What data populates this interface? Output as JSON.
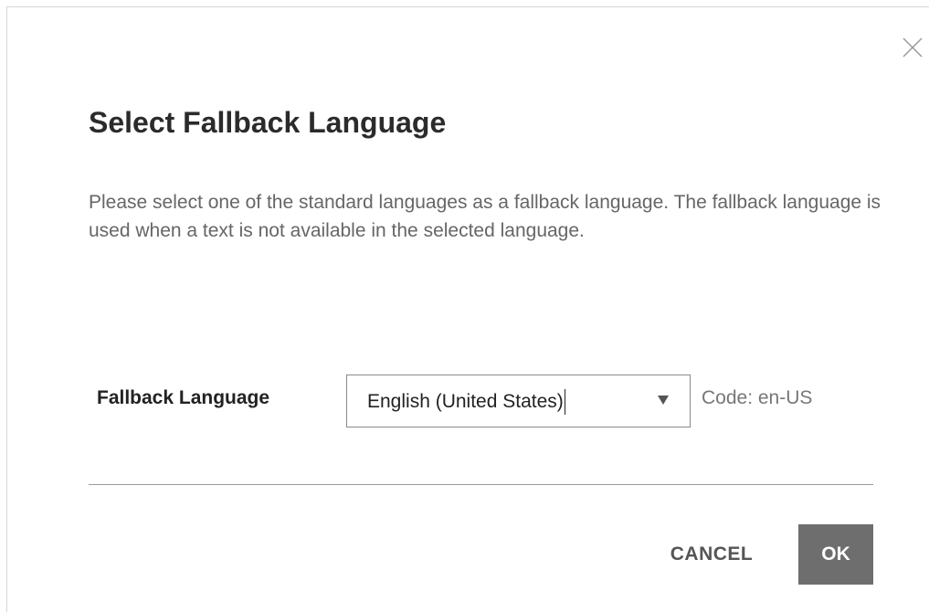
{
  "dialog": {
    "title": "Select Fallback Language",
    "description": "Please select one of the standard languages as a fallback language. The fallback language is used when a text is not available in the selected language.",
    "close_icon": "close-icon"
  },
  "form": {
    "field_label": "Fallback Language",
    "selected_value": "English (United States)",
    "dropdown_icon": "triangle-down-icon",
    "code_text": "Code: en-US"
  },
  "actions": {
    "cancel_label": "CANCEL",
    "ok_label": "OK"
  },
  "colors": {
    "ok_button_bg": "#6e6e6e",
    "title_text": "#2b2b2b",
    "body_text": "#666666"
  }
}
